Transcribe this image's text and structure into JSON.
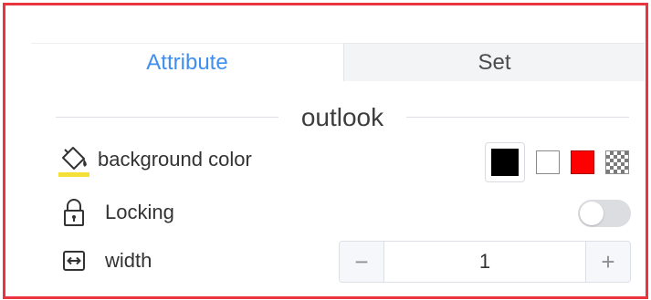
{
  "tabs": [
    {
      "label": "Attribute",
      "active": true
    },
    {
      "label": "Set",
      "active": false
    }
  ],
  "section": {
    "title": "outlook"
  },
  "background_color": {
    "label": "background color",
    "icon": "paint-bucket-icon",
    "indicator_color": "#f5e03a",
    "selected_color": "#000000",
    "swatches": [
      "#ffffff",
      "#ff0000",
      "transparent"
    ]
  },
  "locking": {
    "label": "Locking",
    "icon": "lock-icon",
    "enabled": false
  },
  "width": {
    "label": "width",
    "icon": "resize-horizontal-icon",
    "value": "1",
    "decrement_label": "−",
    "increment_label": "+"
  },
  "colors": {
    "accent": "#3f8ff0",
    "frame_border": "#e8353e"
  }
}
